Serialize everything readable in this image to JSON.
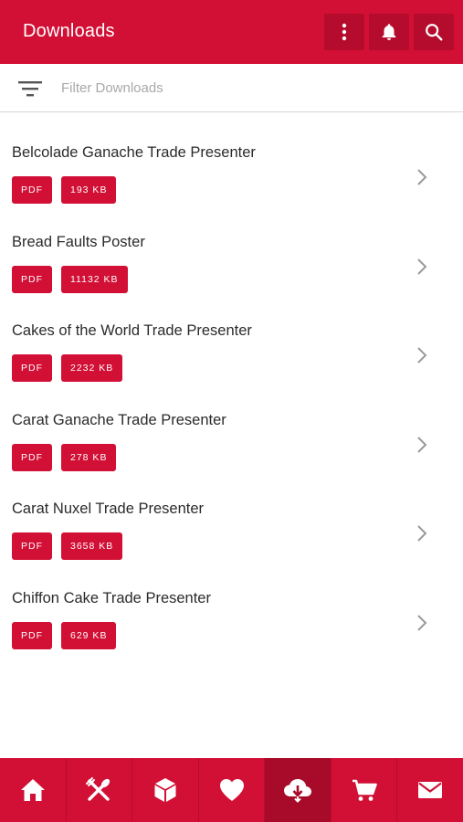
{
  "header": {
    "title": "Downloads",
    "icons": [
      "more-vertical-icon",
      "bell-icon",
      "search-icon"
    ]
  },
  "filter": {
    "placeholder": "Filter Downloads",
    "value": "",
    "icon": "filter-icon"
  },
  "downloads": [
    {
      "name": "Belcolade Ganache Trade Presenter",
      "type": "PDF",
      "size": "193 KB"
    },
    {
      "name": "Bread Faults Poster",
      "type": "PDF",
      "size": "11132 KB"
    },
    {
      "name": "Cakes of the World Trade Presenter",
      "type": "PDF",
      "size": "2232 KB"
    },
    {
      "name": "Carat Ganache Trade Presenter",
      "type": "PDF",
      "size": "278 KB"
    },
    {
      "name": "Carat Nuxel Trade Presenter",
      "type": "PDF",
      "size": "3658 KB"
    },
    {
      "name": "Chiffon Cake Trade Presenter",
      "type": "PDF",
      "size": "629 KB"
    }
  ],
  "bottom_nav": {
    "items": [
      "home-icon",
      "recipes-icon",
      "products-icon",
      "favorites-icon",
      "downloads-icon",
      "cart-icon",
      "mail-icon"
    ],
    "active": "downloads-icon"
  },
  "colors": {
    "brand": "#d20f35",
    "brand_dark": "#b50b2c",
    "active_tab": "#a80a29"
  }
}
